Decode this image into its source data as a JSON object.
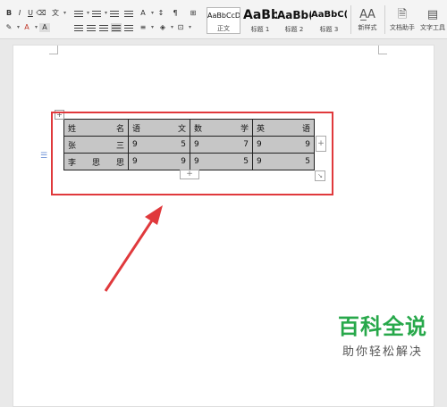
{
  "ribbon": {
    "styles": [
      {
        "sample": "AaBbCcDd",
        "name": "正文"
      },
      {
        "sample": "AaBb",
        "name": "标题 1"
      },
      {
        "sample": "AaBb(",
        "name": "标题 2"
      },
      {
        "sample": "AaBbC(",
        "name": "标题 3"
      }
    ],
    "new_style": "新样式",
    "doc_assistant": "文档助手",
    "text_tools": "文字工具"
  },
  "table": {
    "header": [
      "姓名",
      "语文",
      "数学",
      "英语"
    ],
    "rows": [
      [
        "张三",
        "9",
        "5",
        "9",
        "7",
        "9",
        "9"
      ],
      [
        "李思思",
        "9",
        "9",
        "9",
        "5",
        "9",
        "5"
      ]
    ],
    "row1": {
      "name_a": "张",
      "name_b": "三"
    },
    "row2": {
      "name_a": "李",
      "name_b": "思",
      "name_c": "思"
    },
    "h": {
      "a1": "姓",
      "a2": "名",
      "b1": "语",
      "b2": "文",
      "c1": "数",
      "c2": "学",
      "d1": "英",
      "d2": "语"
    }
  },
  "handles": {
    "move": "+",
    "add_col": "+",
    "add_row": "+",
    "resize": "↘"
  },
  "watermark": {
    "title": "百科全说",
    "subtitle": "助你轻松解决"
  },
  "colors": {
    "highlight": "#e0393c",
    "watermark": "#27a84a",
    "table_fill": "#c6c6c6"
  }
}
